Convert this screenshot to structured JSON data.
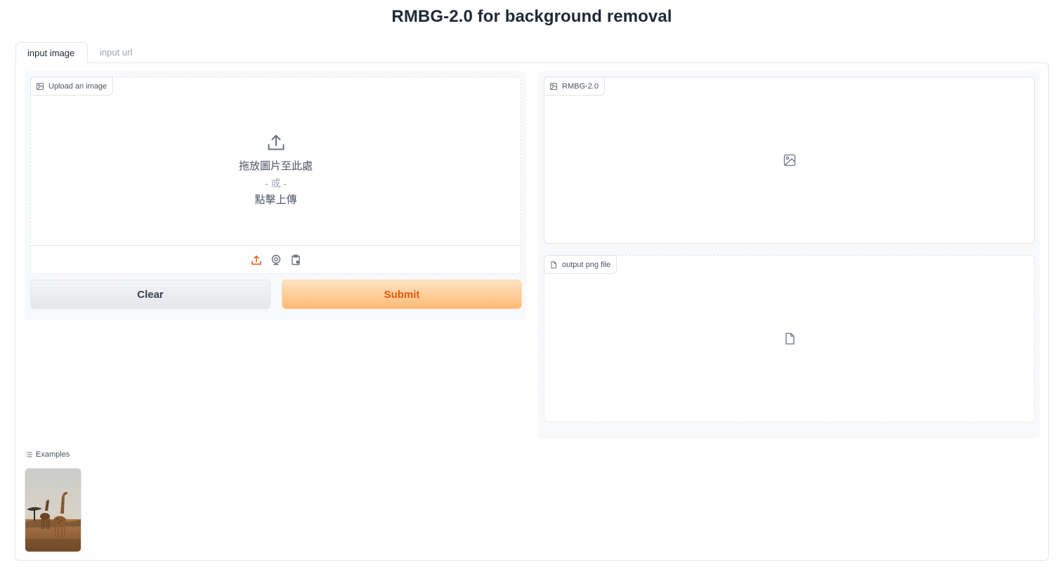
{
  "page": {
    "title": "RMBG-2.0 for background removal"
  },
  "tabs": [
    {
      "label": "input image",
      "active": true
    },
    {
      "label": "input url",
      "active": false
    }
  ],
  "input_block": {
    "label": "Upload an image",
    "label_icon": "image-icon",
    "drop_text": "拖放圖片至此處",
    "or_text": "- 或 -",
    "click_text": "點擊上傳",
    "sources": [
      {
        "icon": "upload-icon",
        "active": true
      },
      {
        "icon": "webcam-icon",
        "active": false
      },
      {
        "icon": "clipboard-icon",
        "active": false
      }
    ]
  },
  "buttons": {
    "clear_label": "Clear",
    "submit_label": "Submit"
  },
  "output_image": {
    "label": "RMBG-2.0",
    "label_icon": "image-icon",
    "placeholder_icon": "image-icon"
  },
  "output_file": {
    "label": "output png file",
    "label_icon": "file-icon",
    "placeholder_icon": "file-icon"
  },
  "examples": {
    "label": "Examples",
    "label_icon": "list-icon",
    "items": [
      {
        "subject": "giraffes"
      }
    ]
  },
  "colors": {
    "accent": "#ea580c",
    "submit_bg_top": "#ffe3c4",
    "submit_bg_bottom": "#fdba74",
    "border": "#e2e4e8",
    "panel_bg": "#f8f9fb"
  }
}
